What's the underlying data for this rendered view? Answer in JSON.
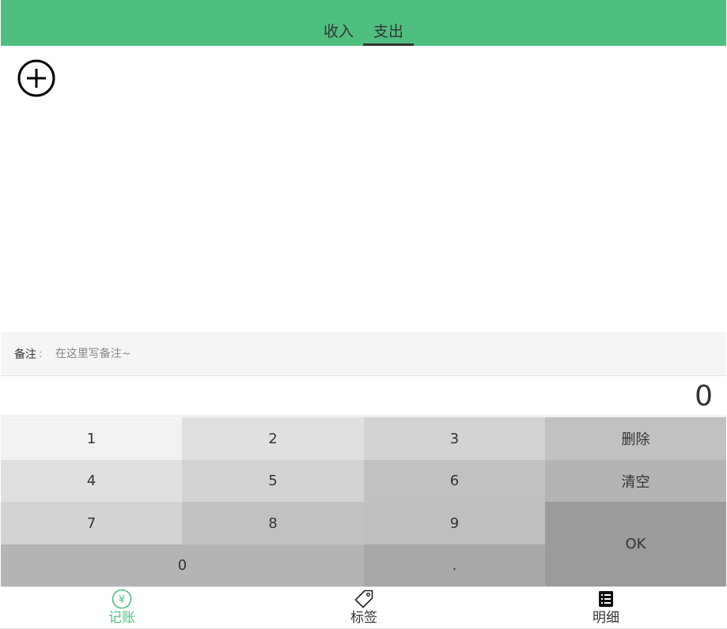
{
  "header": {
    "tabs": [
      {
        "label": "收入",
        "active": false
      },
      {
        "label": "支出",
        "active": true
      }
    ],
    "accent_color": "#4fbf80"
  },
  "tags": {
    "add_icon": "plus-circle-icon"
  },
  "note": {
    "label": "备注",
    "colon": ":",
    "placeholder": "在这里写备注~",
    "value": ""
  },
  "output": {
    "amount": "0"
  },
  "numpad": {
    "keys": {
      "k1": "1",
      "k2": "2",
      "k3": "3",
      "delete": "删除",
      "k4": "4",
      "k5": "5",
      "k6": "6",
      "clear": "清空",
      "k7": "7",
      "k8": "8",
      "k9": "9",
      "ok": "OK",
      "k0": "0",
      "dot": "."
    }
  },
  "nav": {
    "items": [
      {
        "label": "记账",
        "icon": "yen-circle-icon",
        "active": true
      },
      {
        "label": "标签",
        "icon": "tag-icon",
        "active": false
      },
      {
        "label": "明细",
        "icon": "list-icon",
        "active": false
      }
    ]
  }
}
